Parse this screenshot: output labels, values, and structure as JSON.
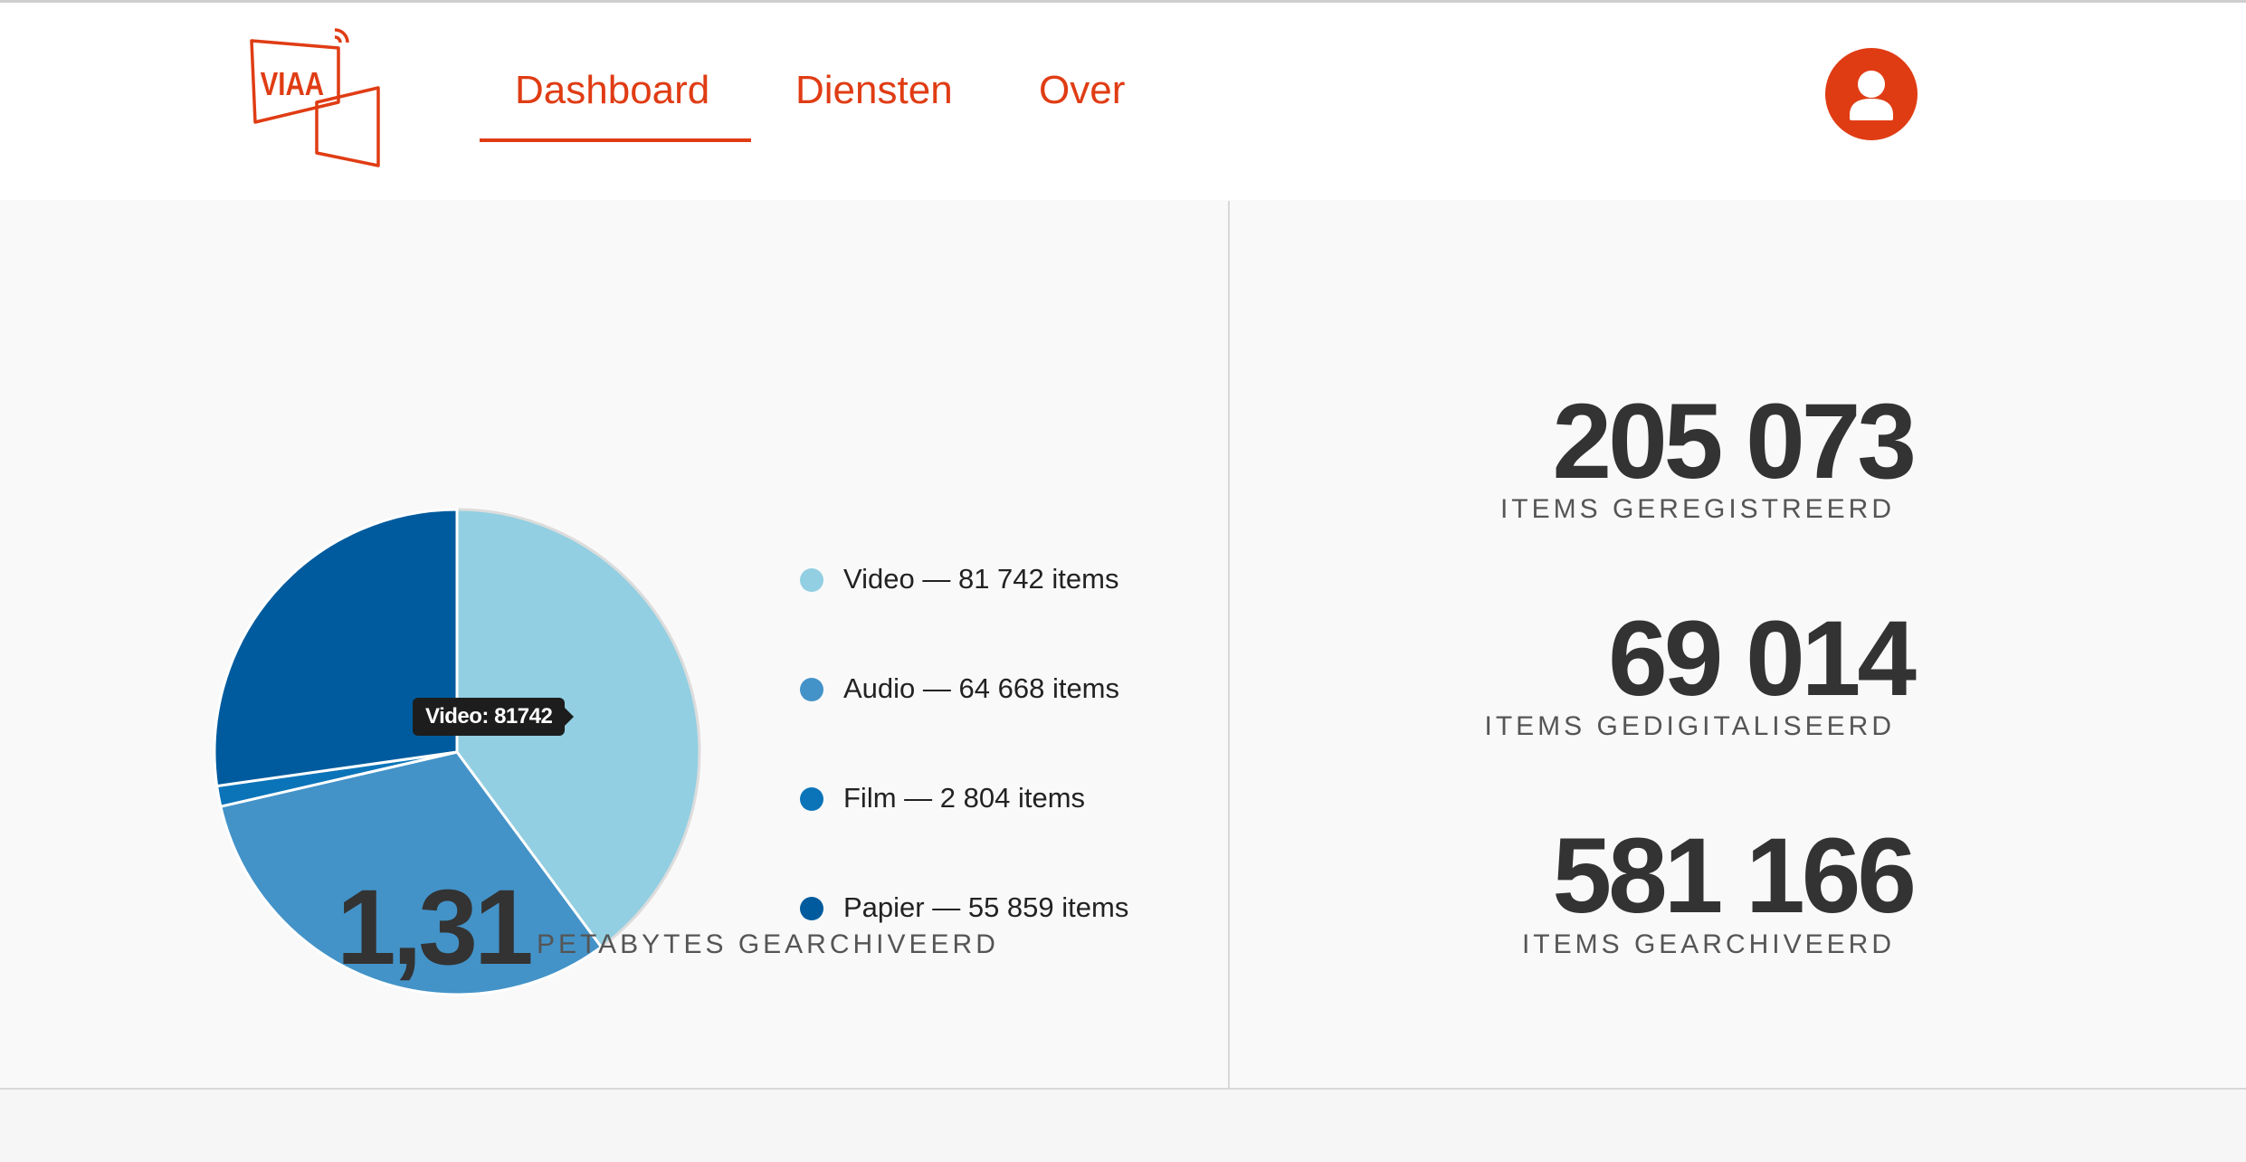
{
  "brand": {
    "logo_text": "VIAA",
    "accent_color": "#e03c14"
  },
  "nav": {
    "items": [
      "Dashboard",
      "Diensten",
      "Over"
    ],
    "active": "Dashboard"
  },
  "user": {
    "icon": "user-icon"
  },
  "chart_data": {
    "type": "pie",
    "categories": [
      "Video",
      "Audio",
      "Film",
      "Papier"
    ],
    "values": [
      81742,
      64668,
      2804,
      55859
    ],
    "colors": [
      "#92cfe2",
      "#4393c8",
      "#0b74b9",
      "#005b9e"
    ],
    "legend": [
      "Video — 81 742 items",
      "Audio — 64 668 items",
      "Film — 2 804 items",
      "Papier — 55 859 items"
    ],
    "legend_placement": "right",
    "tooltip": "Video: 81742"
  },
  "storage": {
    "value": "1,31",
    "label": "PETABYTES GEARCHIVEERD"
  },
  "stats": [
    {
      "value": "205 073",
      "label": "ITEMS GEREGISTREERD"
    },
    {
      "value": "69 014",
      "label": "ITEMS GEDIGITALISEERD"
    },
    {
      "value": "581 166",
      "label": "ITEMS GEARCHIVEERD"
    }
  ]
}
